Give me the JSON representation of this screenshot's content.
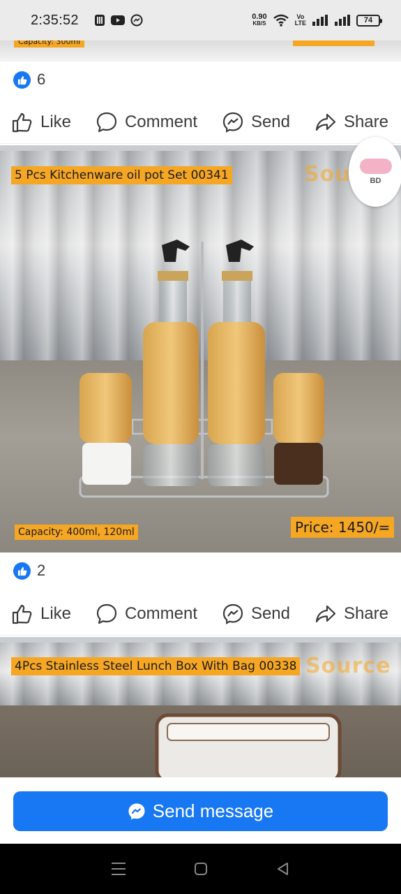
{
  "status_bar": {
    "time": "2:35:52",
    "net_speed_value": "0.90",
    "net_speed_unit": "KB/S",
    "volte_top": "Vo",
    "volte_bottom": "LTE",
    "battery": "74"
  },
  "previous_post": {
    "capacity_tag_partial": "Capacity: 300ml"
  },
  "posts": [
    {
      "reaction_count": "6",
      "actions": {
        "like": "Like",
        "comment": "Comment",
        "send": "Send",
        "share": "Share"
      }
    },
    {
      "title_tag": "5 Pcs Kitchenware oil pot Set 00341",
      "capacity_tag": "Capacity: 400ml, 120ml",
      "price_tag": "Price: 1450/=",
      "watermark": "Source",
      "profile_badge_text": "BD",
      "reaction_count": "2",
      "actions": {
        "like": "Like",
        "comment": "Comment",
        "send": "Send",
        "share": "Share"
      }
    },
    {
      "title_tag": "4Pcs Stainless Steel Lunch Box With Bag 00338",
      "watermark": "Source"
    }
  ],
  "send_message": {
    "label": "Send message"
  },
  "colors": {
    "accent": "#1877f2",
    "tag": "#f5a623"
  }
}
